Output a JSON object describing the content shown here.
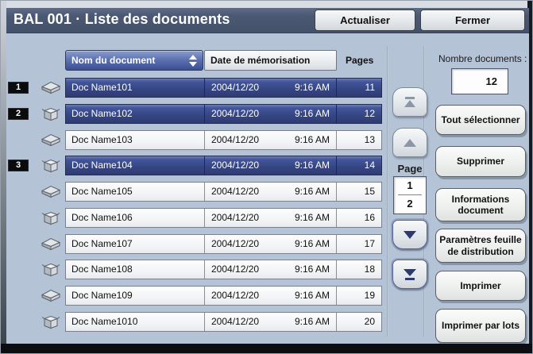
{
  "window": {
    "title": "BAL 001 · Liste des documents",
    "actualiser_label": "Actualiser",
    "fermer_label": "Fermer"
  },
  "table": {
    "columns": {
      "name": "Nom du document",
      "date": "Date de mémorisation",
      "pages": "Pages"
    },
    "sort_icon": "sort-up-down-icon",
    "rows": [
      {
        "badge": "1",
        "selected": true,
        "icon": "scanner",
        "name": "Doc Name101",
        "date": "2004/12/20",
        "time": "9:16 AM",
        "pages": "11"
      },
      {
        "badge": "2",
        "selected": true,
        "icon": "box",
        "name": "Doc Name102",
        "date": "2004/12/20",
        "time": "9:16 AM",
        "pages": "12"
      },
      {
        "badge": "",
        "selected": false,
        "icon": "scanner",
        "name": "Doc Name103",
        "date": "2004/12/20",
        "time": "9:16 AM",
        "pages": "13"
      },
      {
        "badge": "3",
        "selected": true,
        "icon": "box",
        "name": "Doc Name104",
        "date": "2004/12/20",
        "time": "9:16 AM",
        "pages": "14"
      },
      {
        "badge": "",
        "selected": false,
        "icon": "scanner",
        "name": "Doc Name105",
        "date": "2004/12/20",
        "time": "9:16 AM",
        "pages": "15"
      },
      {
        "badge": "",
        "selected": false,
        "icon": "box",
        "name": "Doc Name106",
        "date": "2004/12/20",
        "time": "9:16 AM",
        "pages": "16"
      },
      {
        "badge": "",
        "selected": false,
        "icon": "scanner",
        "name": "Doc Name107",
        "date": "2004/12/20",
        "time": "9:16 AM",
        "pages": "17"
      },
      {
        "badge": "",
        "selected": false,
        "icon": "box",
        "name": "Doc Name108",
        "date": "2004/12/20",
        "time": "9:16 AM",
        "pages": "18"
      },
      {
        "badge": "",
        "selected": false,
        "icon": "scanner",
        "name": "Doc Name109",
        "date": "2004/12/20",
        "time": "9:16 AM",
        "pages": "19"
      },
      {
        "badge": "",
        "selected": false,
        "icon": "box",
        "name": "Doc Name1010",
        "date": "2004/12/20",
        "time": "9:16 AM",
        "pages": "20"
      }
    ]
  },
  "pager": {
    "label": "Page",
    "current": "1",
    "total": "2"
  },
  "panel": {
    "count_label": "Nombre documents :",
    "count_value": "12",
    "buttons": [
      "Tout sélectionner",
      "Supprimer",
      "Informations document",
      "Paramètres feuille de distribution",
      "Imprimer",
      "Imprimer par lots"
    ]
  },
  "colors": {
    "background": "#b5c3d7",
    "titlebar": "#4b5974",
    "selected_row": "#37467f",
    "header_blue": "#4c5fa2",
    "button_face": "#eef0ee",
    "badge": "#0a0b0d"
  }
}
